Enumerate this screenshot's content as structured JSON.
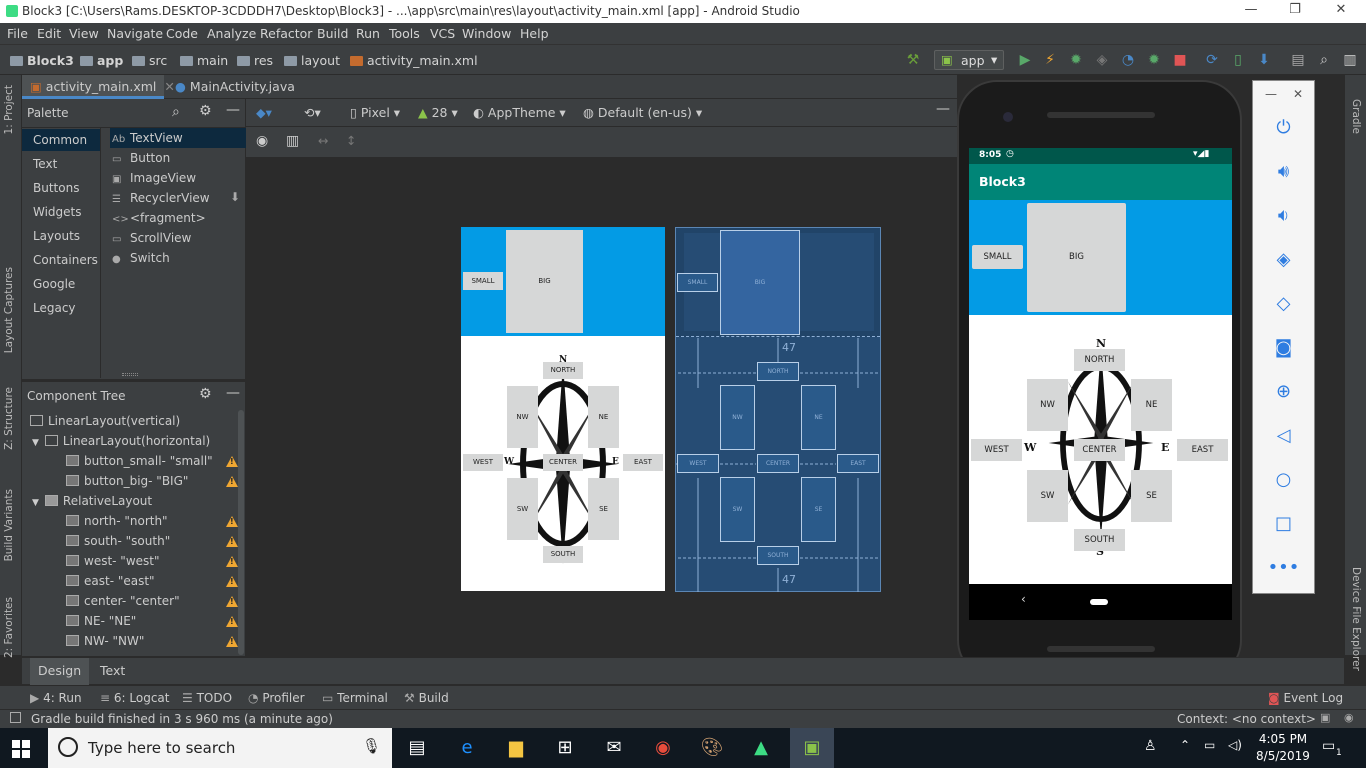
{
  "window": {
    "title": "Block3 [C:\\Users\\Rams.DESKTOP-3CDDDH7\\Desktop\\Block3] - ...\\app\\src\\main\\res\\layout\\activity_main.xml [app] - Android Studio",
    "min": "—",
    "max": "❐",
    "close": "✕"
  },
  "menu": [
    "File",
    "Edit",
    "View",
    "Navigate",
    "Code",
    "Analyze",
    "Refactor",
    "Build",
    "Run",
    "Tools",
    "VCS",
    "Window",
    "Help"
  ],
  "breadcrumbs": [
    "Block3",
    "app",
    "src",
    "main",
    "res",
    "layout",
    "activity_main.xml"
  ],
  "run_config": "app",
  "editor_tabs": [
    {
      "label": "activity_main.xml",
      "active": true
    },
    {
      "label": "MainActivity.java",
      "active": false
    }
  ],
  "left_strip": [
    "1: Project",
    "Layout Captures",
    "Z: Structure",
    "Build Variants",
    "2: Favorites"
  ],
  "right_strip": [
    "Gradle",
    "Device File Explorer"
  ],
  "palette": {
    "title": "Palette",
    "categories": [
      "Common",
      "Text",
      "Buttons",
      "Widgets",
      "Layouts",
      "Containers",
      "Google",
      "Legacy"
    ],
    "items": [
      {
        "icon": "Ab",
        "label": "TextView"
      },
      {
        "icon": "▭",
        "label": "Button"
      },
      {
        "icon": "▣",
        "label": "ImageView"
      },
      {
        "icon": "☰",
        "label": "RecyclerView"
      },
      {
        "icon": "<>",
        "label": "<fragment>"
      },
      {
        "icon": "▭",
        "label": "ScrollView"
      },
      {
        "icon": "●",
        "label": "Switch"
      }
    ]
  },
  "component_tree": {
    "title": "Component Tree",
    "nodes": [
      {
        "label": "LinearLayout",
        "sub": "(vertical)",
        "warn": false
      },
      {
        "label": "LinearLayout",
        "sub": "(horizontal)",
        "warn": false
      },
      {
        "label": "button_small",
        "sub": "- \"small\"",
        "warn": true
      },
      {
        "label": "button_big",
        "sub": "- \"BIG\"",
        "warn": true
      },
      {
        "label": "RelativeLayout",
        "sub": "",
        "warn": false
      },
      {
        "label": "north",
        "sub": "- \"north\"",
        "warn": true
      },
      {
        "label": "south",
        "sub": "- \"south\"",
        "warn": true
      },
      {
        "label": "west",
        "sub": "- \"west\"",
        "warn": true
      },
      {
        "label": "east",
        "sub": "- \"east\"",
        "warn": true
      },
      {
        "label": "center",
        "sub": "- \"center\"",
        "warn": true
      },
      {
        "label": "NE",
        "sub": "- \"NE\"",
        "warn": true
      },
      {
        "label": "NW",
        "sub": "- \"NW\"",
        "warn": true
      }
    ]
  },
  "design_toolbar": {
    "device": "Pixel",
    "api": "28",
    "theme": "AppTheme",
    "locale": "Default (en-us)"
  },
  "preview": {
    "small": "SMALL",
    "big": "BIG",
    "north": "NORTH",
    "south": "SOUTH",
    "west": "WEST",
    "east": "EAST",
    "center": "CENTER",
    "ne": "NE",
    "nw": "NW",
    "se": "SE",
    "sw": "SW",
    "n": "N",
    "s": "S",
    "w": "W",
    "e": "E",
    "margin": "47"
  },
  "bottom_tabs": [
    "Design",
    "Text"
  ],
  "tool_windows": [
    "4: Run",
    "6: Logcat",
    "TODO",
    "Profiler",
    "Terminal",
    "Build"
  ],
  "event_log": "Event Log",
  "status": {
    "message": "Gradle build finished in 3 s 960 ms (a minute ago)",
    "context": "Context: <no context>"
  },
  "emulator": {
    "time": "8:05",
    "app_title": "Block3"
  },
  "taskbar": {
    "search_placeholder": "Type here to search",
    "time": "4:05 PM",
    "date": "8/5/2019",
    "notifications": "1"
  },
  "colors": {
    "accent_blue": "#039be5",
    "app_bar": "#008577",
    "status_bar": "#00574b",
    "warning": "#f0a732"
  }
}
